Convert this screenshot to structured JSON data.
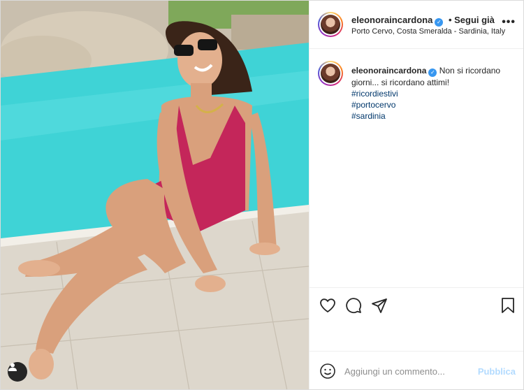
{
  "post": {
    "username": "eleonoraincardona",
    "verified": true,
    "follow_status": "• Segui già",
    "location": "Porto Cervo, Costa Smeralda - Sardinia, Italy",
    "more_label": "•••"
  },
  "caption": {
    "username": "eleonoraincardona",
    "text": "Non si ricordano giorni... si ricordano attimi!",
    "hashtags": [
      "#ricordiestivi",
      "#portocervo",
      "#sardinia"
    ]
  },
  "actions": {
    "icons": [
      "heart-icon",
      "comment-icon",
      "share-icon",
      "bookmark-icon"
    ]
  },
  "comment_bar": {
    "placeholder": "Aggiungi un commento...",
    "publish_label": "Pubblica"
  },
  "colors": {
    "pool": "#3fd3d6",
    "swimsuit": "#c4265a",
    "link": "#00376b",
    "verified": "#3897f0",
    "publish": "#b3dbff"
  }
}
